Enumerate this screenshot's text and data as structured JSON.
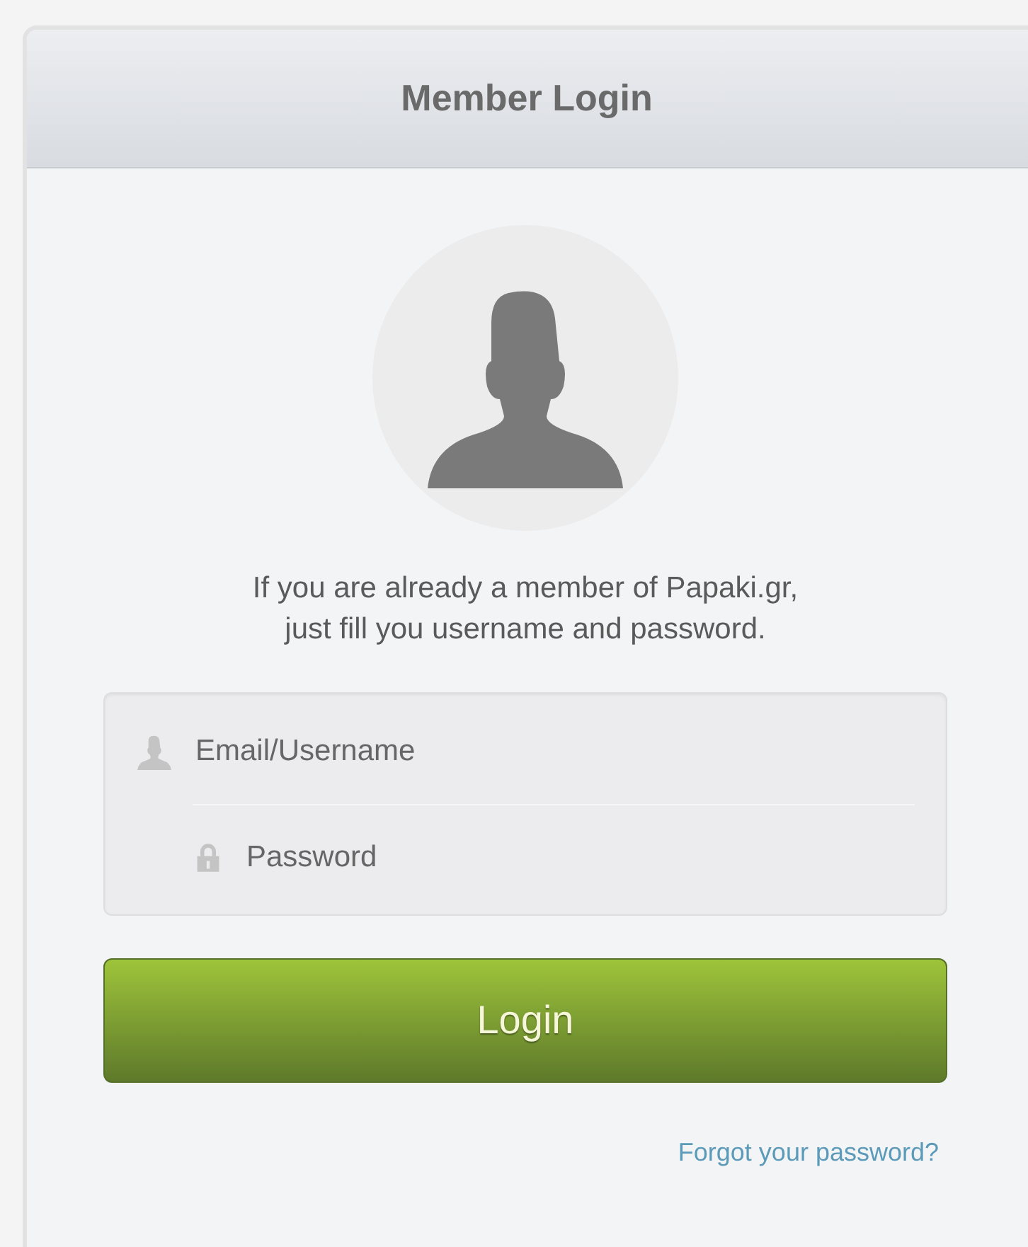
{
  "header": {
    "title": "Member Login"
  },
  "intro": [
    "If you are already a member of Papaki.gr,",
    "just fill you username and password."
  ],
  "fields": [
    {
      "kind": "user",
      "placeholder": "Email/Username"
    },
    {
      "kind": "lock",
      "placeholder": "Password"
    }
  ],
  "login_button": "Login",
  "forgot_link": "Forgot your password?"
}
